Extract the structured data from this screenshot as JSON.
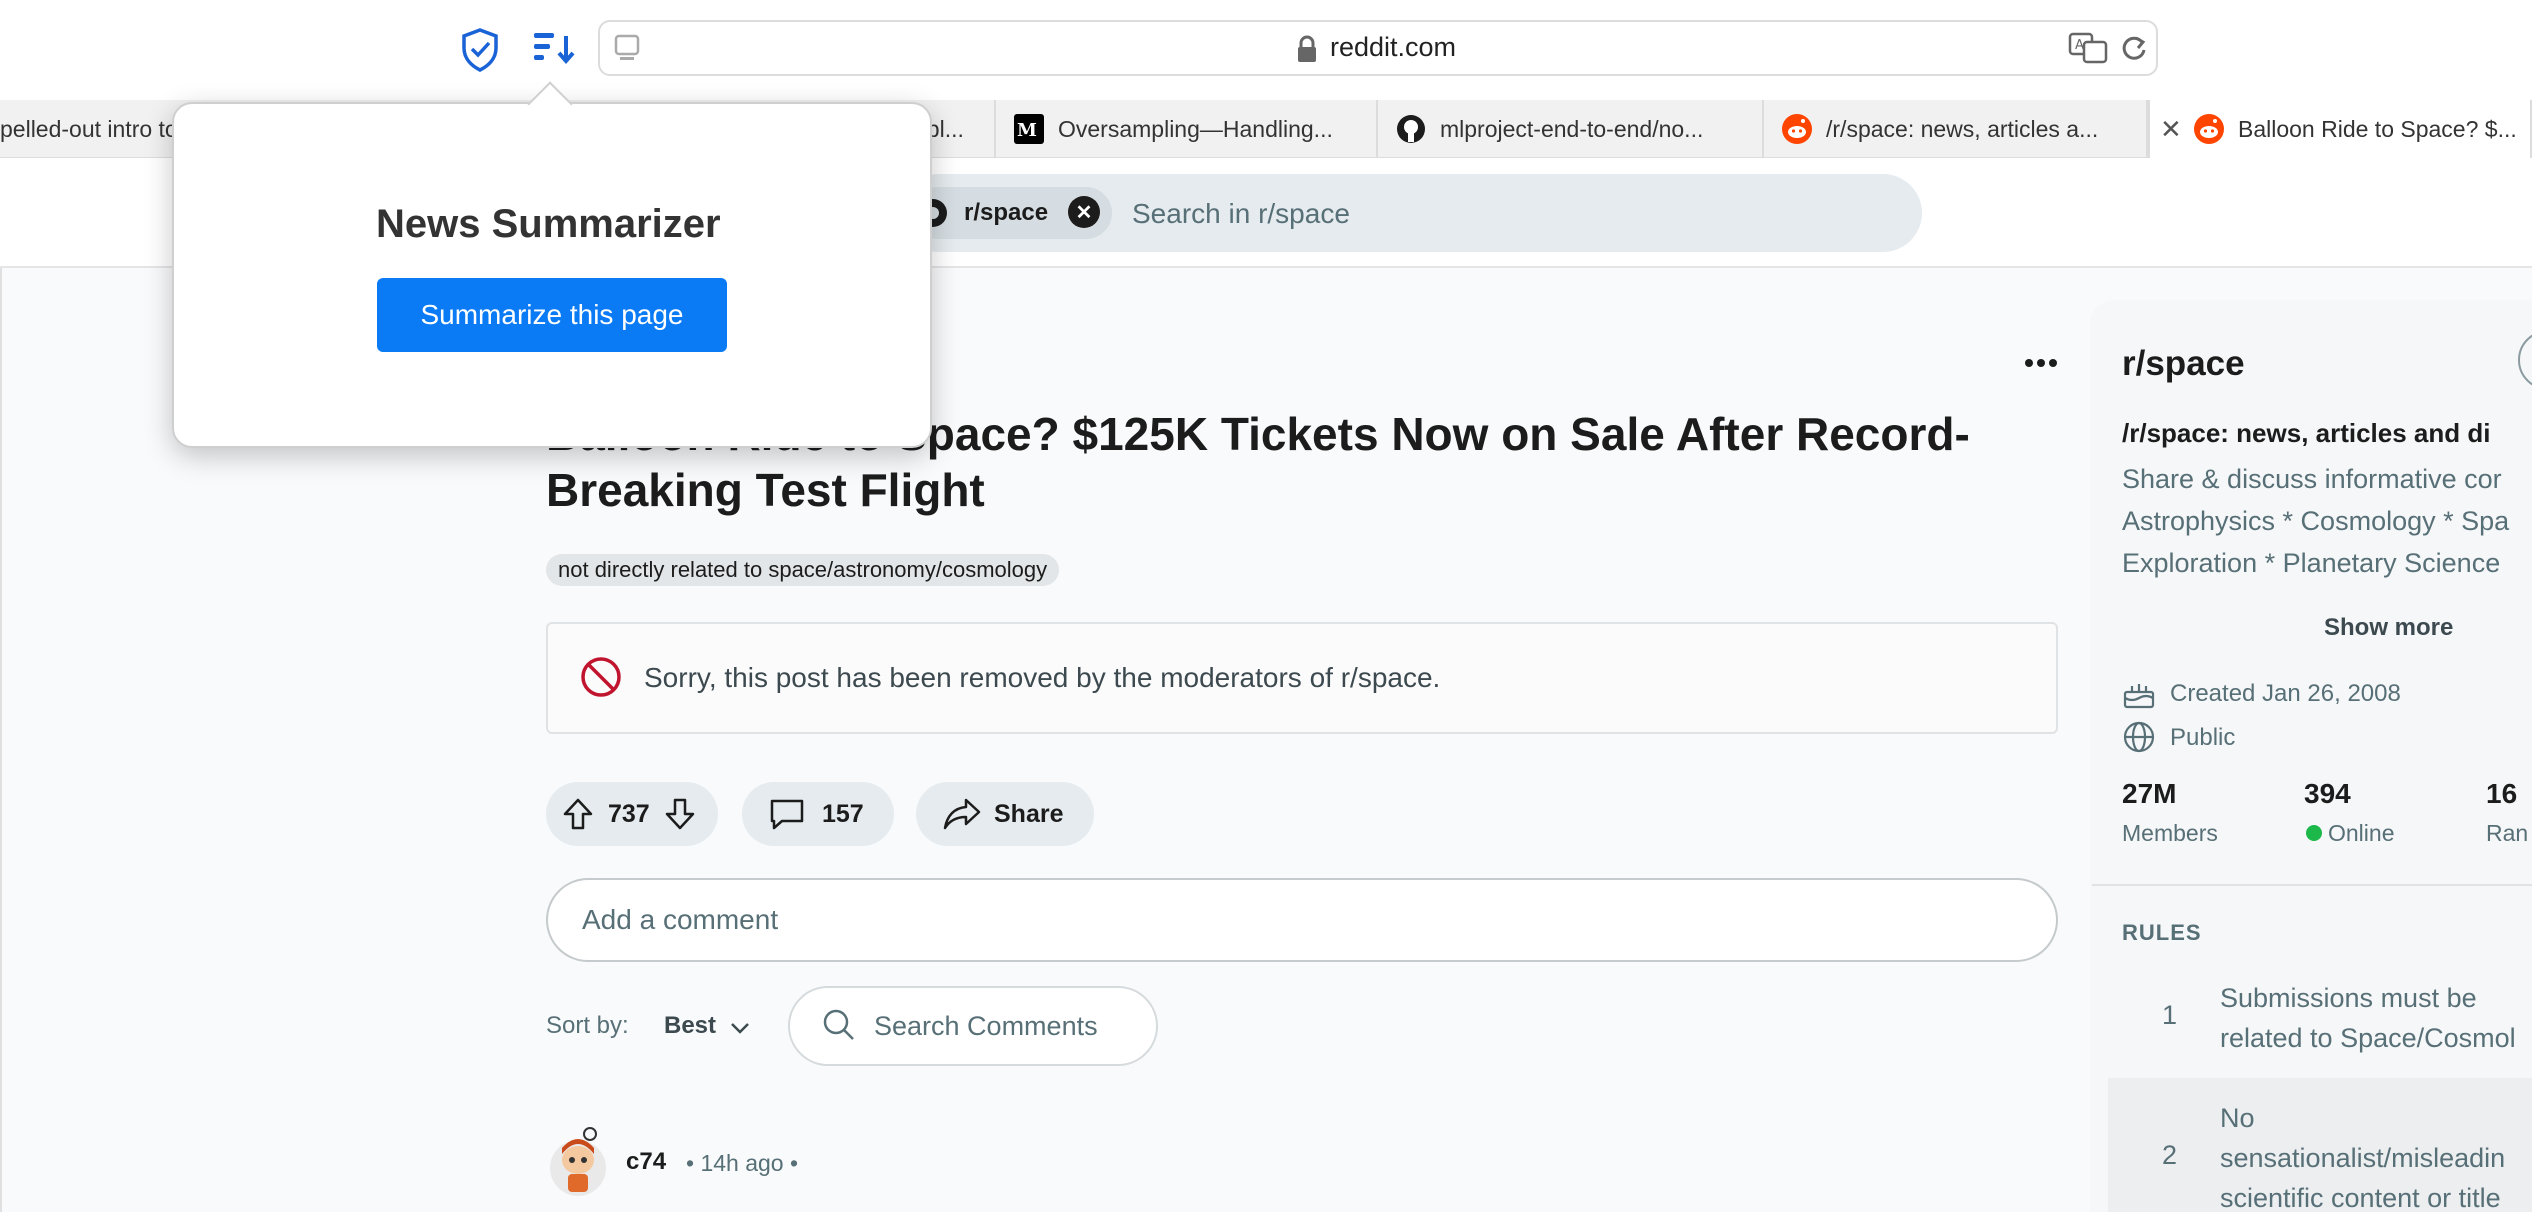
{
  "browser": {
    "url": "reddit.com",
    "tabs": [
      {
        "label": "pelled-out intro to"
      },
      {
        "label": "ppl..."
      },
      {
        "label": "Oversampling—Handling..."
      },
      {
        "label": "mlproject-end-to-end/no..."
      },
      {
        "label": "/r/space: news, articles a..."
      },
      {
        "label": "Balloon Ride to Space? $..."
      }
    ]
  },
  "extension_popup": {
    "title": "News Summarizer",
    "button_label": "Summarize this page"
  },
  "header": {
    "community_chip": "r/space",
    "search_placeholder": "Search in r/space"
  },
  "post": {
    "title": "Balloon Ride to Space? $125K Tickets Now on Sale After Record-Breaking Test Flight",
    "flair": "not directly related to space/astronomy/cosmology",
    "removed_notice": "Sorry, this post has been removed by the moderators of r/space.",
    "votes": "737",
    "comments_count": "157",
    "share_label": "Share",
    "comment_placeholder": "Add a comment",
    "sort_label": "Sort by:",
    "sort_value": "Best",
    "search_comments_placeholder": "Search Comments"
  },
  "first_comment": {
    "author": "c74",
    "meta": "• 14h ago •"
  },
  "sidebar": {
    "name": "r/space",
    "subtitle": "/r/space: news, articles and di",
    "description_lines": [
      "Share & discuss informative cor",
      "Astrophysics * Cosmology * Spa",
      "Exploration * Planetary Science"
    ],
    "show_more": "Show more",
    "created": "Created Jan 26, 2008",
    "visibility": "Public",
    "stats": [
      {
        "value": "27M",
        "label": "Members"
      },
      {
        "value": "394",
        "label": "Online"
      },
      {
        "value": "16",
        "label": "Ran"
      }
    ],
    "rules_heading": "RULES",
    "rules": [
      {
        "num": "1",
        "lines": [
          "Submissions must be",
          "related to Space/Cosmol"
        ]
      },
      {
        "num": "2",
        "lines": [
          "No",
          "sensationalist/misleadin",
          "scientific content or title"
        ]
      }
    ]
  },
  "colors": {
    "accent_blue": "#0a7af5",
    "reddit_orange": "#ff4500",
    "online_green": "#1cb84a",
    "removed_red": "#c0142f"
  }
}
